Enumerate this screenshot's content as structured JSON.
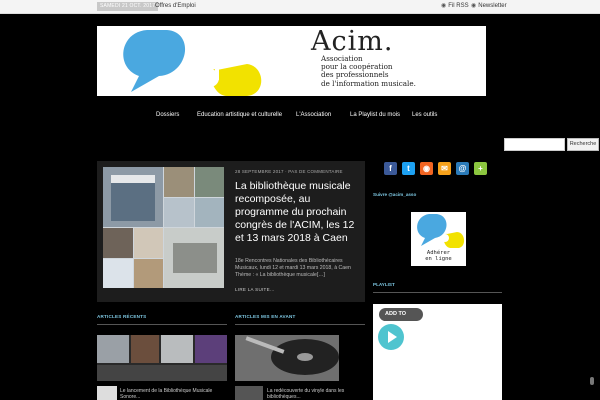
{
  "topbar": {
    "date": "SAMEDI 21 OCT. 2017",
    "link": "Offres d'Emploi",
    "rss_label": "Fil RSS",
    "newsletter_label": "Newsletter"
  },
  "header": {
    "brand": "Acim.",
    "tagline": "Association\npour la coopération\ndes professionnels\nde l'information musicale."
  },
  "nav": {
    "items": [
      "Dossiers",
      "Education artistique et culturelle",
      "L'Association",
      "La Playlist du mois",
      "Les outils"
    ]
  },
  "search": {
    "placeholder": "",
    "button": "Recherche"
  },
  "featured": {
    "meta": "28 SEPTEMBRE 2017 · PAS DE COMMENTAIRE",
    "title": "La bibliothèque musicale recomposée, au programme du prochain congrès de l'ACIM, les 12 et 13 mars 2018 à Caen",
    "excerpt": "18e Rencontres Nationales des Bibliothécaires Musicaux, lundi 12 et mardi 13 mars 2018, à Caen Thème : « La bibliothèque musicale[…]",
    "more": "LIRE LA SUITE..."
  },
  "sections": {
    "recent": "ARTICLES RÉCENTS",
    "forward": "ARTICLES MIS EN AVANT",
    "twitter": "Suivre @acim_asso",
    "playlist": "PLAYLIST"
  },
  "captions": {
    "recent": "Le lancement de la Bibliothèque Musicale Sonore...",
    "forward": "La redécouverte du vinyle dans les bibliothèques..."
  },
  "sidebar": {
    "adherer": "Adhérer\nen ligne",
    "social_icons": [
      "facebook-icon",
      "twitter-icon",
      "rss-icon",
      "chat-icon",
      "mail-icon",
      "share-icon"
    ]
  },
  "player": {
    "add_label": "ADD TO"
  },
  "colors": {
    "accent": "#7ec8e3",
    "logo_blue": "#4aa8e0",
    "logo_yellow": "#f2e200",
    "play": "#4fc4cf"
  }
}
